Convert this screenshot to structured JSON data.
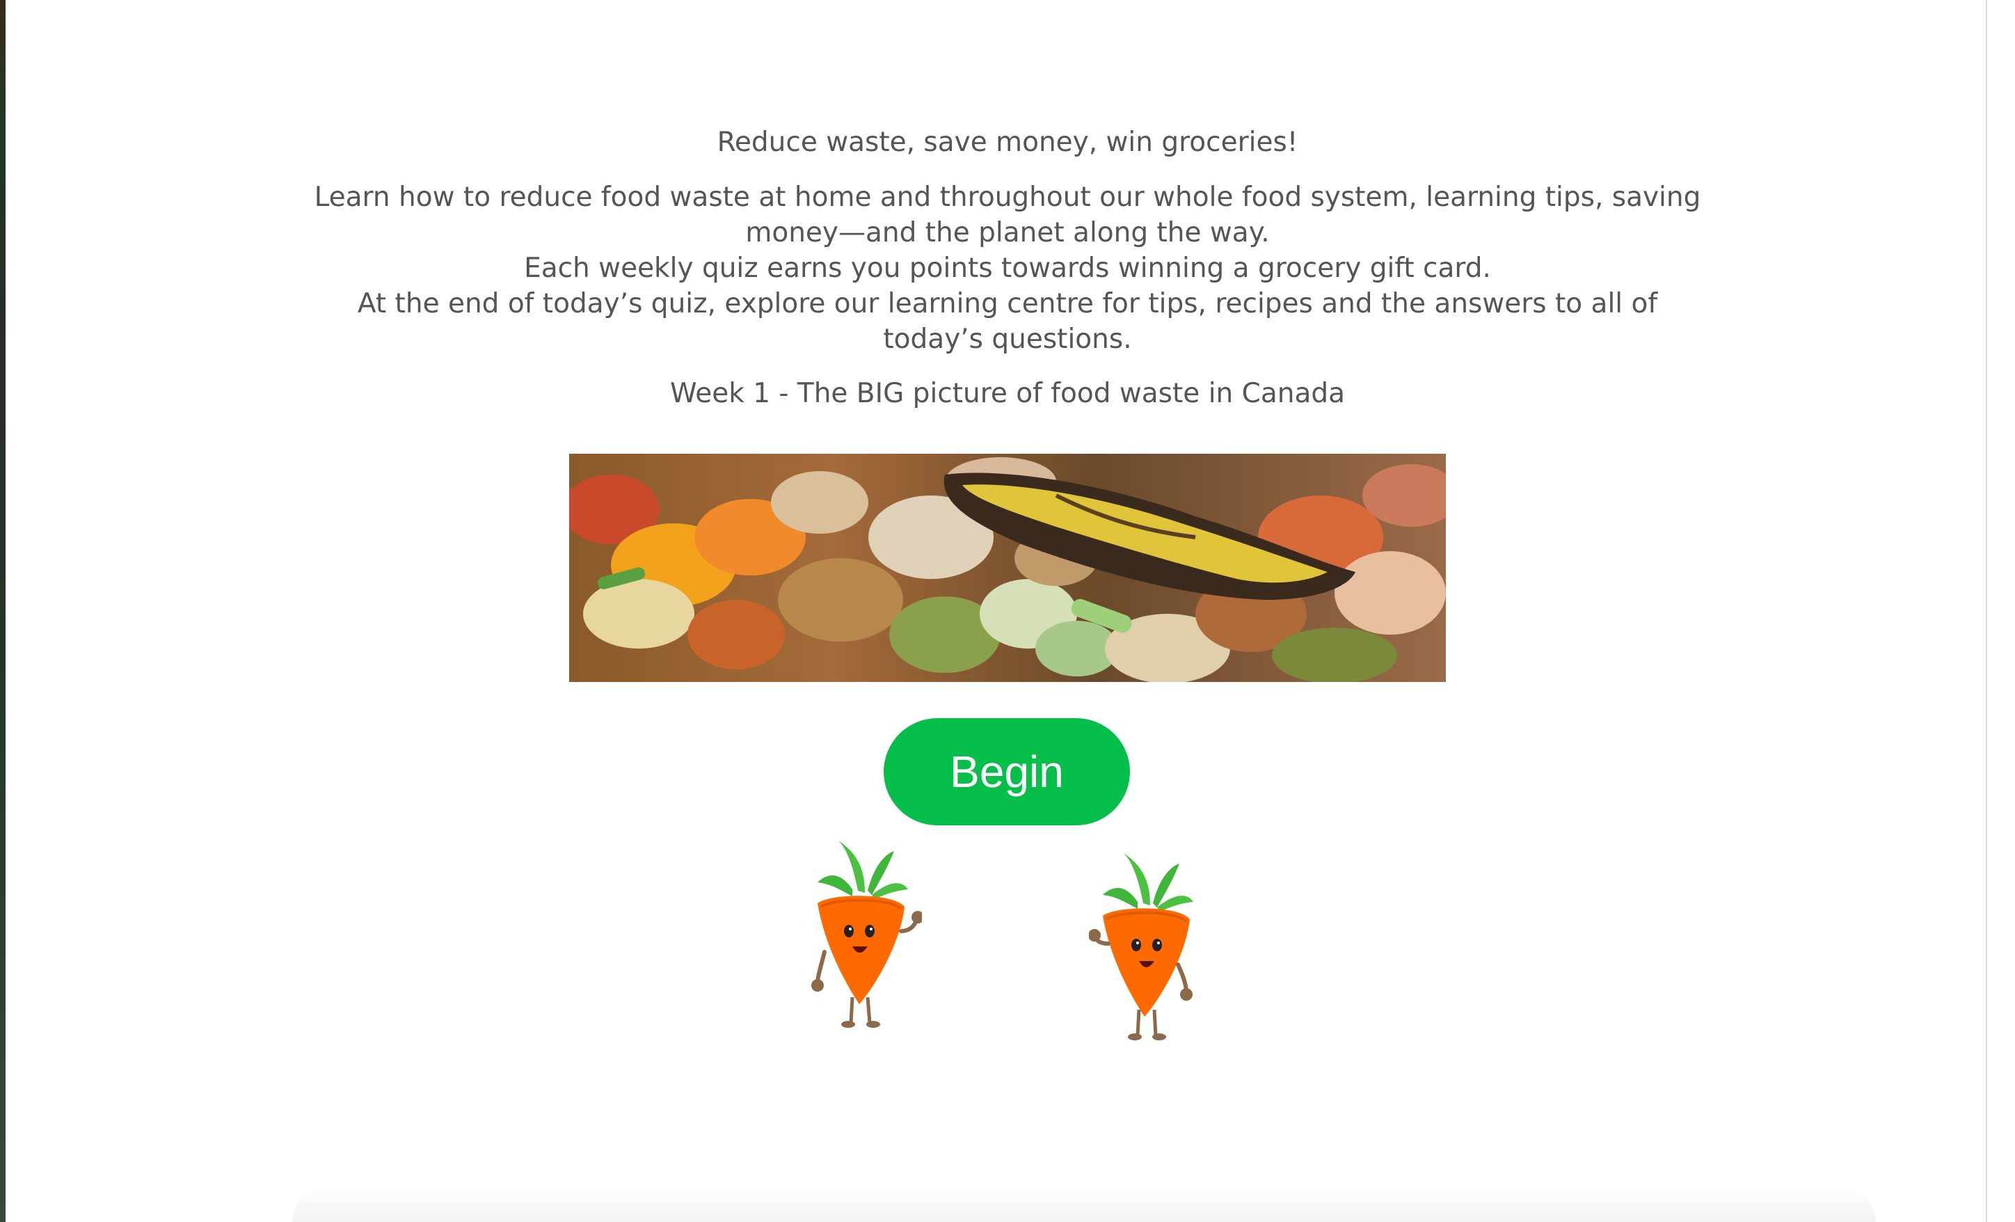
{
  "page": {
    "tagline": "Reduce waste, save money, win groceries!",
    "intro_lines": [
      "Learn how to reduce food waste at home and throughout our whole food system, learning tips, saving money—and the planet along the way.",
      "Each weekly quiz earns you points towards winning a grocery gift card.",
      "At the end of today’s quiz, explore our learning centre for tips, recipes and the answers to all of today’s questions."
    ],
    "week_title": "Week 1 - The BIG picture of food waste in Canada"
  },
  "actions": {
    "begin_label": "Begin"
  },
  "images": {
    "hero": "food-waste-compost-photo",
    "mascots": [
      "carrot-mascot",
      "carrot-mascot"
    ]
  },
  "colors": {
    "begin_button": "#06bf4a",
    "text": "#555555",
    "carrot_body": "#ff6a00",
    "carrot_leaves": "#3fb53a"
  }
}
